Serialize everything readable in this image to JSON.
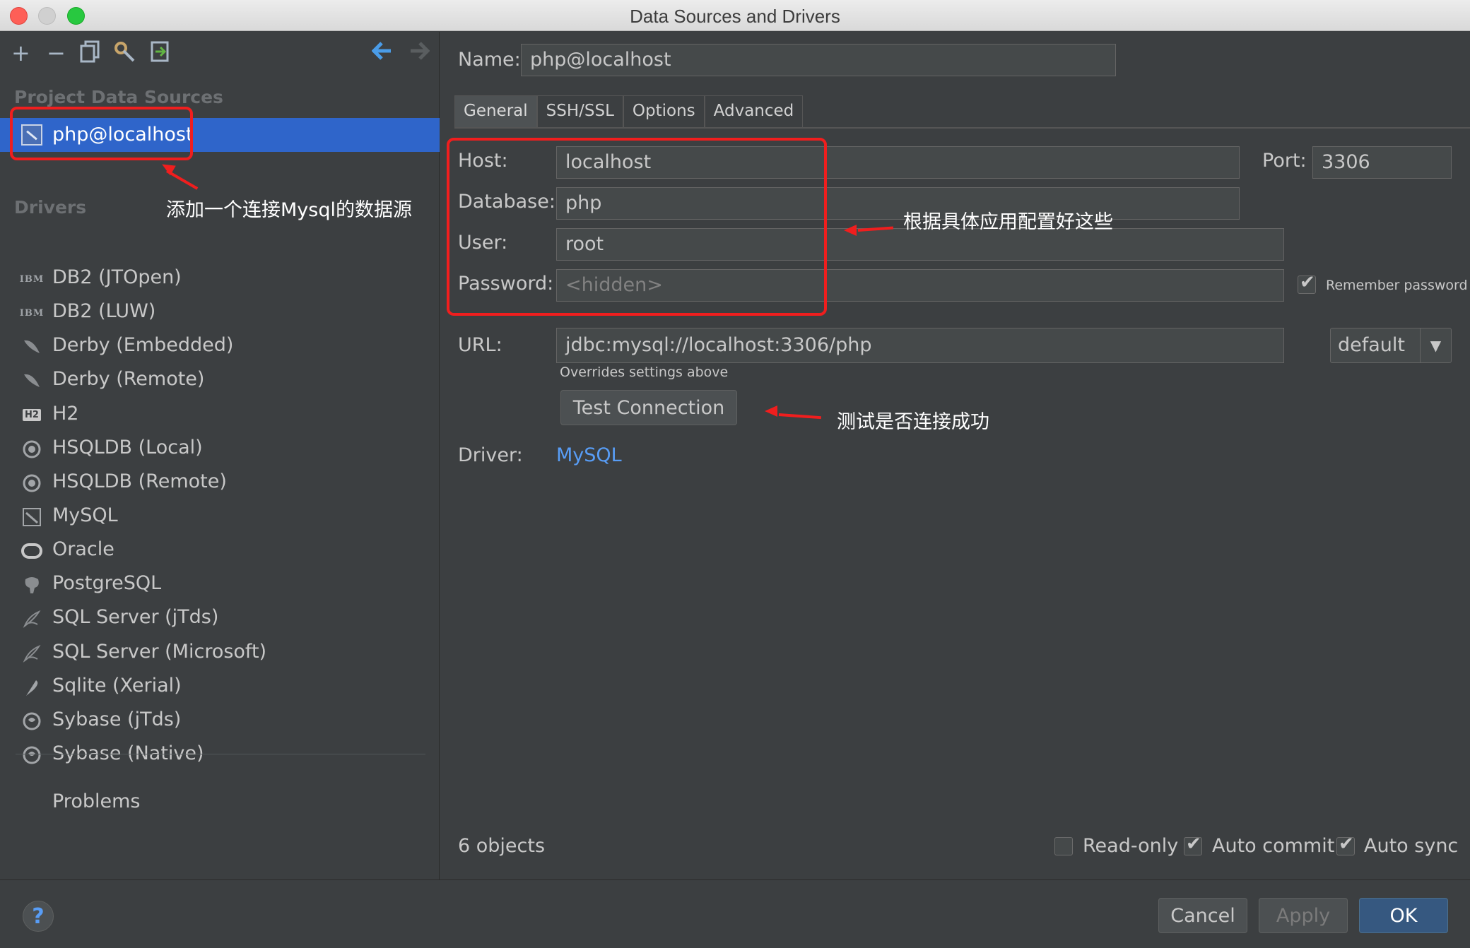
{
  "window": {
    "title": "Data Sources and Drivers"
  },
  "left": {
    "project_section": "Project Data Sources",
    "datasource": "php@localhost",
    "drivers_section": "Drivers",
    "drivers": [
      {
        "label": "DB2 (JTOpen)",
        "icon": "ibm-icon"
      },
      {
        "label": "DB2 (LUW)",
        "icon": "ibm-icon"
      },
      {
        "label": "Derby (Embedded)",
        "icon": "derby-icon"
      },
      {
        "label": "Derby (Remote)",
        "icon": "derby-icon"
      },
      {
        "label": "H2",
        "icon": "h2-icon"
      },
      {
        "label": "HSQLDB (Local)",
        "icon": "hsqldb-icon"
      },
      {
        "label": "HSQLDB (Remote)",
        "icon": "hsqldb-icon"
      },
      {
        "label": "MySQL",
        "icon": "mysql-icon"
      },
      {
        "label": "Oracle",
        "icon": "oracle-icon"
      },
      {
        "label": "PostgreSQL",
        "icon": "postgresql-icon"
      },
      {
        "label": "SQL Server (jTds)",
        "icon": "sqlserver-icon"
      },
      {
        "label": "SQL Server (Microsoft)",
        "icon": "sqlserver-icon"
      },
      {
        "label": "Sqlite (Xerial)",
        "icon": "sqlite-icon"
      },
      {
        "label": "Sybase (jTds)",
        "icon": "sybase-icon"
      },
      {
        "label": "Sybase (Native)",
        "icon": "sybase-icon"
      }
    ],
    "problems": "Problems",
    "ibm_glyph": "IBM",
    "h2_glyph": "H2"
  },
  "form": {
    "name_label": "Name:",
    "name_value": "php@localhost",
    "tabs": [
      "General",
      "SSH/SSL",
      "Options",
      "Advanced"
    ],
    "host_label": "Host:",
    "host_value": "localhost",
    "port_label": "Port:",
    "port_value": "3306",
    "database_label": "Database:",
    "database_value": "php",
    "user_label": "User:",
    "user_value": "root",
    "password_label": "Password:",
    "password_placeholder": "<hidden>",
    "remember_password": "Remember password",
    "url_label": "URL:",
    "url_value": "jdbc:mysql://localhost:3306/php",
    "url_mode": "default",
    "overrides_note": "Overrides settings above",
    "test_connection": "Test Connection",
    "driver_label": "Driver:",
    "driver_link": "MySQL",
    "objects_count": "6 objects",
    "readonly": "Read-only",
    "auto_commit": "Auto commit",
    "auto_sync": "Auto sync"
  },
  "buttons": {
    "cancel": "Cancel",
    "apply": "Apply",
    "ok": "OK",
    "help": "?"
  },
  "annotations": {
    "add_datasource": "添加一个连接Mysql的数据源",
    "configure": "根据具体应用配置好这些",
    "test": "测试是否连接成功"
  },
  "colors": {
    "selection": "#2f65ca",
    "link": "#589df6",
    "annotation": "#f01e1e",
    "primary_button": "#365880"
  }
}
